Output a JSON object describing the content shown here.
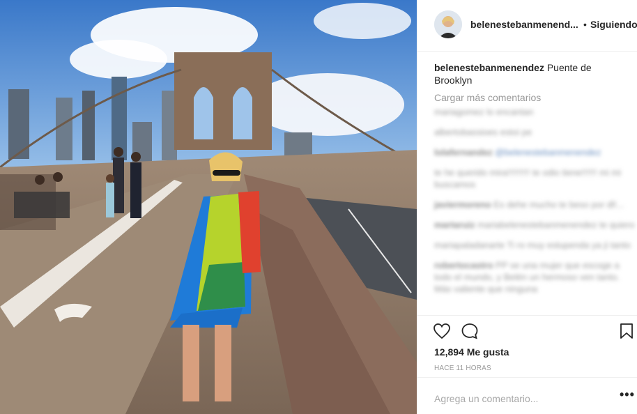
{
  "post": {
    "username": "belenestebanmenendez",
    "username_display": "belenestebanmenend...",
    "follow_separator": "•",
    "follow_status": "Siguiendo",
    "caption_user": "belenestebanmenendez",
    "caption_text": "Puente de Brooklyn",
    "load_more": "Cargar más comentarios",
    "likes": "12,894 Me gusta",
    "timestamp": "HACE 11 HORAS",
    "comment_placeholder": "Agrega un comentario...",
    "more_options": "•••"
  },
  "comments": [
    {
      "user": "",
      "text": "mariagomez lo encantan",
      "mention": ""
    },
    {
      "user": "",
      "text": "albertobassioes estoi pe",
      "mention": ""
    },
    {
      "user": "lolafernandez",
      "text": "",
      "mention": "@belenestebanmenendez"
    },
    {
      "user": "",
      "text": "te he querido mira!!!!!!!!! te odio tiene!!!!!! mi mi buscamos",
      "mention": ""
    },
    {
      "user": "javiermoreno",
      "text": "Es dehe mucho te beso por dl!...",
      "mention": ""
    },
    {
      "user": "martaruiz",
      "text": "mariabelenestebanmenendez te quiero",
      "mention": ""
    },
    {
      "user": "",
      "text": "mariapaladanarte Ti ro muy estupenda ya ji tanto",
      "mention": ""
    },
    {
      "user": "robertocastro",
      "text": "PP se una mujer que escoge a todo el mundo, y Belén un hermoso ven tanto. Más valiente que ninguna",
      "mention": ""
    }
  ],
  "icons": {
    "like": "heart-icon",
    "comment": "speech-bubble-icon",
    "save": "bookmark-icon",
    "more": "more-options-icon"
  },
  "colors": {
    "text": "#262626",
    "muted": "#999999",
    "border": "#efefef"
  }
}
